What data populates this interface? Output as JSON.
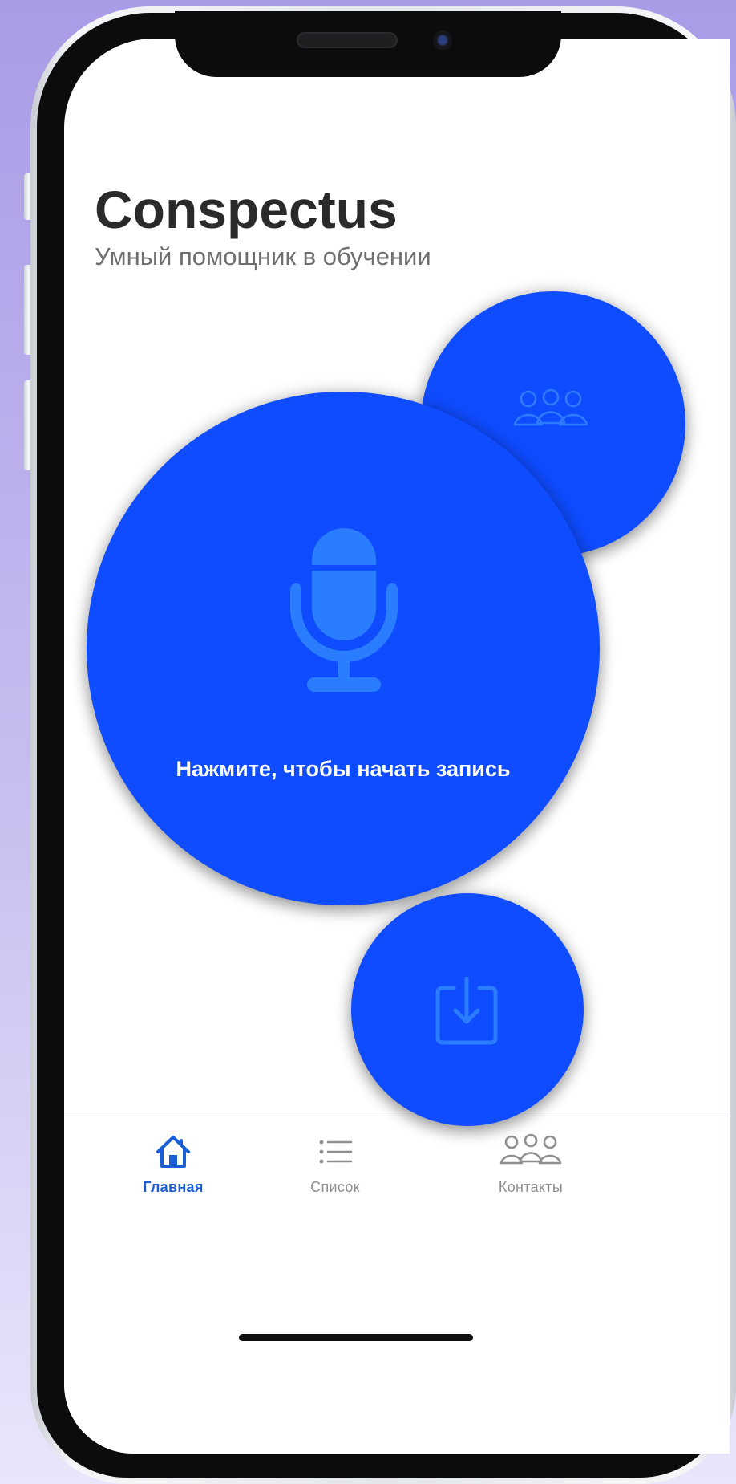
{
  "header": {
    "title": "Conspectus",
    "subtitle": "Умный помощник в обучении"
  },
  "main": {
    "record_label": "Нажмите, чтобы начать запись"
  },
  "tabbar": {
    "items": [
      {
        "label": "Главная",
        "icon": "house-icon",
        "active": true
      },
      {
        "label": "Список",
        "icon": "list-icon",
        "active": false
      },
      {
        "label": "Контакты",
        "icon": "contacts-icon",
        "active": false
      }
    ]
  },
  "colors": {
    "accent": "#0f4cff",
    "active_tab": "#1a5fd8",
    "inactive_tab": "#8e8e93"
  }
}
